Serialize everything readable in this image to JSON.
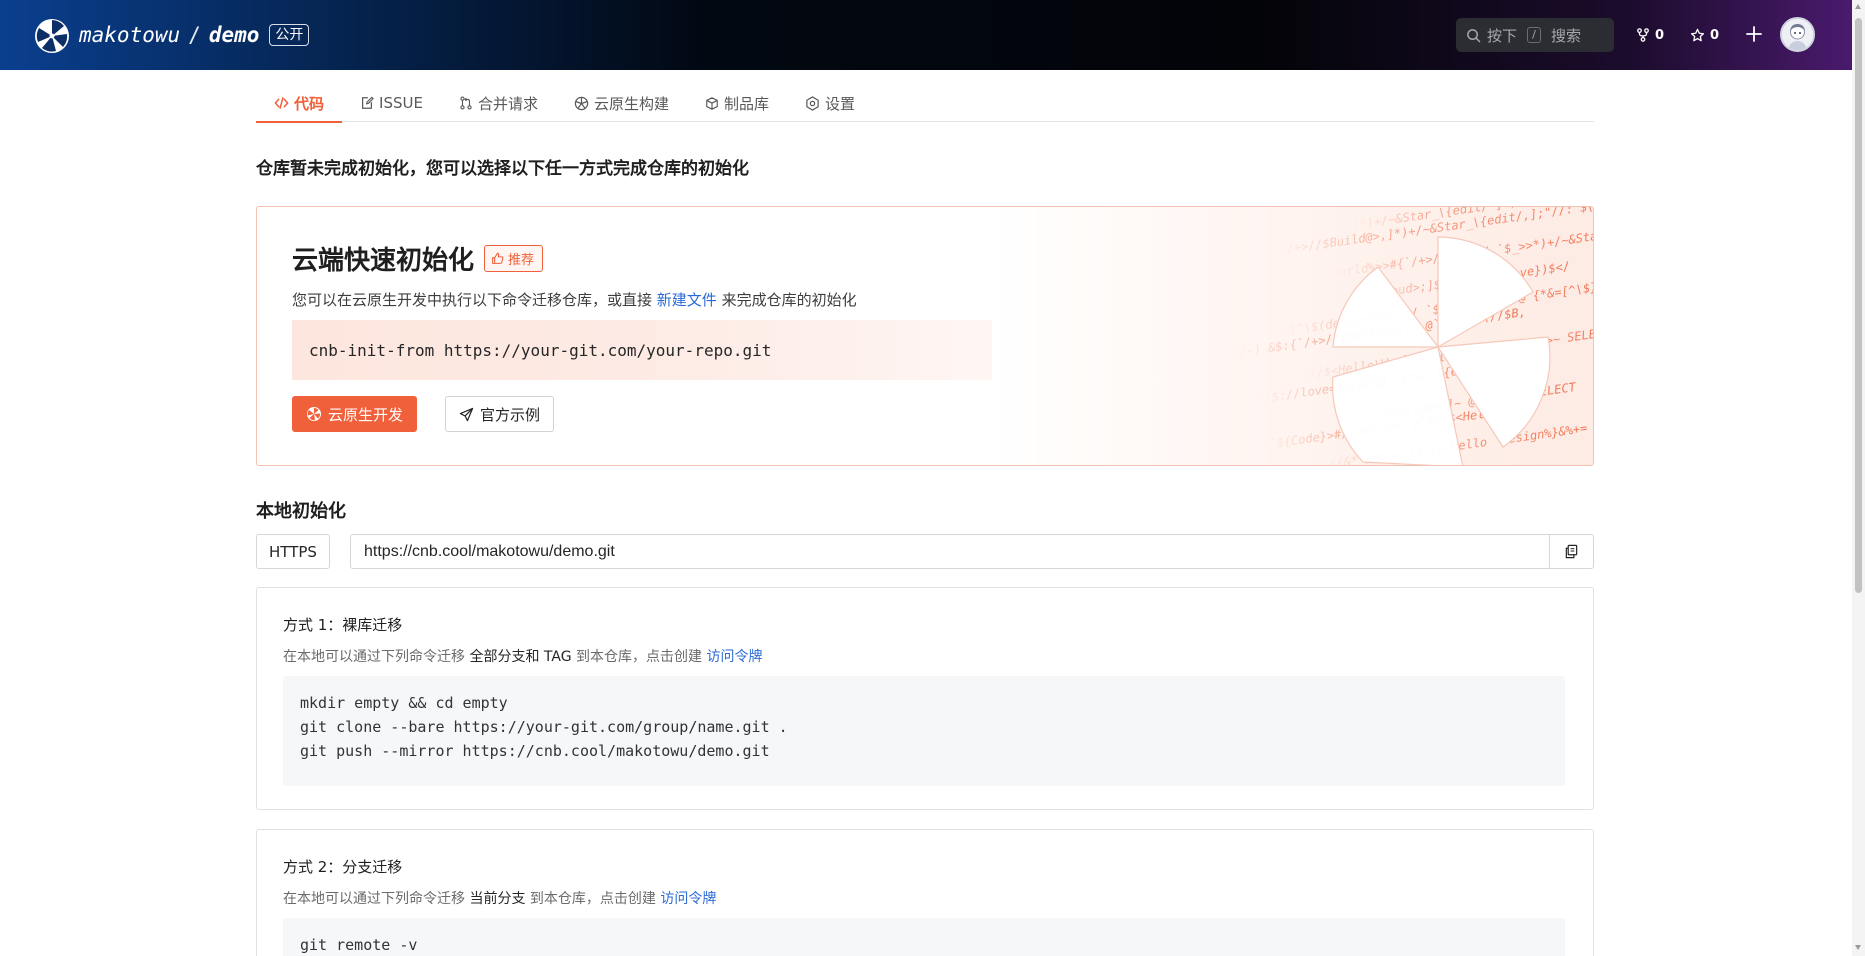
{
  "header": {
    "owner": "makotowu",
    "separator": "/",
    "repo": "demo",
    "visibility_badge": "公开",
    "search": {
      "placeholder_prefix": "按下",
      "shortcut_key": "/",
      "placeholder_suffix": "搜索"
    },
    "forks_count": "0",
    "stars_count": "0",
    "icons": [
      "cnb-logo-icon",
      "search-icon",
      "fork-icon",
      "star-icon",
      "plus-icon"
    ]
  },
  "tabs": [
    {
      "label": "代码",
      "icon": "code-icon",
      "active": true
    },
    {
      "label": "ISSUE",
      "icon": "issue-icon",
      "active": false
    },
    {
      "label": "合并请求",
      "icon": "pull-request-icon",
      "active": false
    },
    {
      "label": "云原生构建",
      "icon": "build-icon",
      "active": false
    },
    {
      "label": "制品库",
      "icon": "package-icon",
      "active": false
    },
    {
      "label": "设置",
      "icon": "settings-icon",
      "active": false
    }
  ],
  "notice": "仓库暂未完成初始化，您可以选择以下任一方式完成仓库的初始化",
  "cloud_init": {
    "title": "云端快速初始化",
    "recommend_badge": "推荐",
    "desc_before": "您可以在云原生开发中执行以下命令迁移仓库，或直接 ",
    "desc_link": "新建文件",
    "desc_after": " 来完成仓库的初始化",
    "command": "cnb-init-from https://your-git.com/your-repo.git",
    "primary_button": "云原生开发",
    "secondary_button": "官方示例"
  },
  "local_init": {
    "title": "本地初始化",
    "protocol_button": "HTTPS",
    "clone_url": "https://cnb.cool/makotowu/demo.git"
  },
  "methods": [
    {
      "title": "方式 1：裸库迁移",
      "desc_before": "在本地可以通过下列命令迁移 ",
      "desc_em": "全部分支和 TAG",
      "desc_middle": " 到本仓库，点击创建 ",
      "desc_link": "访问令牌",
      "code": [
        "mkdir empty && cd empty",
        "git clone --bare https://your-git.com/group/name.git .",
        "git push --mirror https://cnb.cool/makotowu/demo.git"
      ]
    },
    {
      "title": "方式 2：分支迁移",
      "desc_before": "在本地可以通过下列命令迁移 ",
      "desc_em": "当前分支",
      "desc_middle": " 到本仓库，点击创建 ",
      "desc_link": "访问令牌",
      "code": [
        "git remote -v"
      ]
    }
  ],
  "colors": {
    "accent": "#f0603a",
    "link": "#2b6ad6"
  }
}
